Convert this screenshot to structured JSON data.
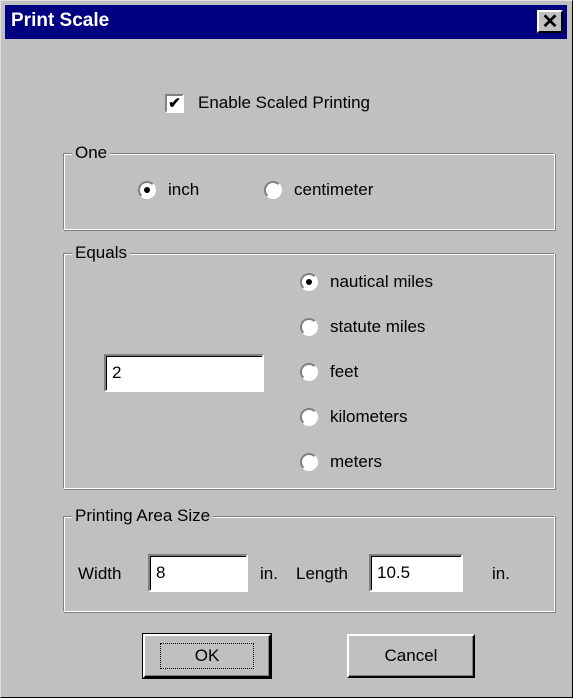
{
  "window": {
    "title": "Print Scale"
  },
  "enable_scaled_printing": {
    "label": "Enable Scaled Printing",
    "checked": true
  },
  "one_group": {
    "label": "One",
    "options": [
      {
        "label": "inch",
        "checked": true
      },
      {
        "label": "centimeter",
        "checked": false
      }
    ]
  },
  "equals_group": {
    "label": "Equals",
    "value": "2",
    "options": [
      {
        "label": "nautical miles",
        "checked": true
      },
      {
        "label": "statute miles",
        "checked": false
      },
      {
        "label": "feet",
        "checked": false
      },
      {
        "label": "kilometers",
        "checked": false
      },
      {
        "label": "meters",
        "checked": false
      }
    ]
  },
  "printing_area": {
    "label": "Printing Area Size",
    "width_label": "Width",
    "width_value": "8",
    "width_unit": "in.",
    "length_label": "Length",
    "length_value": "10.5",
    "length_unit": "in."
  },
  "buttons": {
    "ok": "OK",
    "cancel": "Cancel"
  }
}
